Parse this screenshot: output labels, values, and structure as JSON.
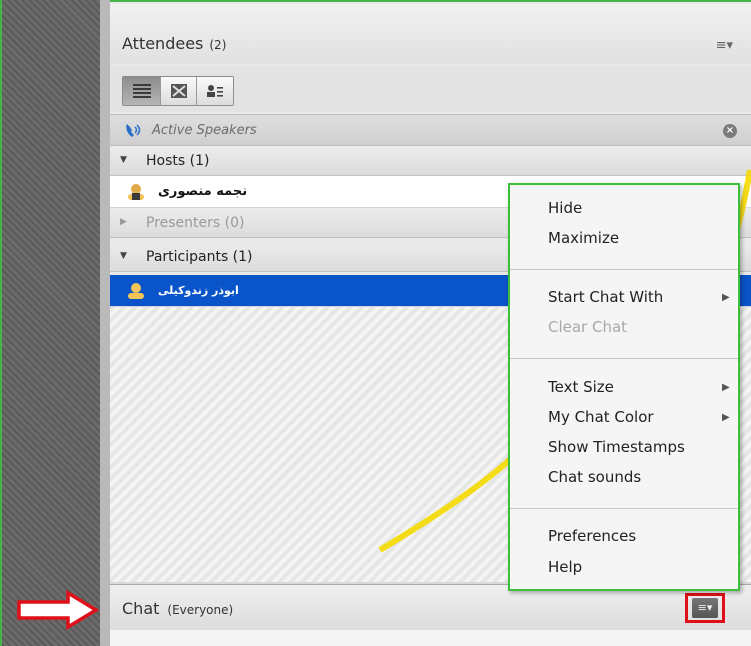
{
  "attendees": {
    "title": "Attendees",
    "count": "(2)",
    "active_speakers_label": "Active Speakers",
    "groups": {
      "hosts": {
        "label": "Hosts (1)",
        "members": [
          "نجمه منصوری"
        ]
      },
      "presenters": {
        "label": "Presenters (0)",
        "members": []
      },
      "participants": {
        "label": "Participants (1)",
        "members": [
          "ابوذر زندوکیلی"
        ]
      }
    }
  },
  "chat": {
    "title": "Chat",
    "scope": "(Everyone)"
  },
  "context_menu": {
    "hide": "Hide",
    "maximize": "Maximize",
    "start_chat_with": "Start Chat With",
    "clear_chat": "Clear Chat",
    "text_size": "Text Size",
    "my_chat_color": "My Chat Color",
    "show_timestamps": "Show Timestamps",
    "chat_sounds": "Chat sounds",
    "preferences": "Preferences",
    "help": "Help"
  },
  "icons": {
    "view_list": "list-view-icon",
    "view_grid": "grid-view-icon",
    "view_card": "card-view-icon",
    "speaker": "phone-speaker-icon",
    "close": "close-icon",
    "host_user": "host-user-icon",
    "participant_user": "participant-user-icon",
    "menu": "menu-icon",
    "arrow": "red-arrow-icon"
  },
  "colors": {
    "selection": "#0a54c9",
    "highlight_red": "#e0101a",
    "highlight_green": "#3cc03c",
    "watermark_yellow": "#f4d900"
  }
}
